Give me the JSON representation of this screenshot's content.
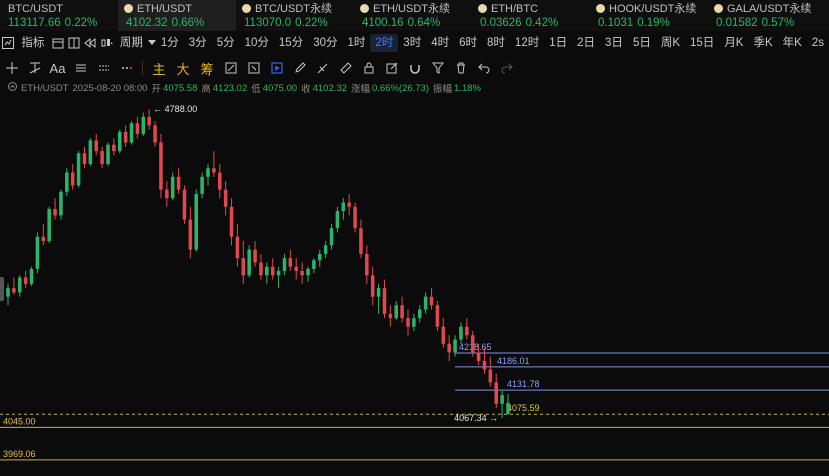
{
  "tickers": [
    {
      "name": "BTC/USDT",
      "price": "113117.66",
      "change": "0.22%",
      "dot": false,
      "active": false
    },
    {
      "name": "ETH/USDT",
      "price": "4102.32",
      "change": "0.66%",
      "dot": true,
      "active": true
    },
    {
      "name": "BTC/USDT永续",
      "price": "113070.0",
      "change": "0.22%",
      "dot": true,
      "active": false
    },
    {
      "name": "ETH/USDT永续",
      "price": "4100.16",
      "change": "0.64%",
      "dot": true,
      "active": false
    },
    {
      "name": "ETH/BTC",
      "price": "0.03626",
      "change": "0.42%",
      "dot": true,
      "active": false
    },
    {
      "name": "HOOK/USDT永续",
      "price": "0.1031",
      "change": "0.19%",
      "dot": true,
      "active": false
    },
    {
      "name": "GALA/USDT永续",
      "price": "0.01582",
      "change": "0.57%",
      "dot": true,
      "active": false
    }
  ],
  "toolbar": {
    "indicators_label": "指标",
    "period_label": "周期",
    "periods": [
      "1分",
      "3分",
      "5分",
      "10分",
      "15分",
      "30分",
      "1时",
      "2时",
      "3时",
      "4时",
      "6时",
      "8时",
      "12时",
      "1日",
      "2日",
      "3日",
      "5日",
      "周K",
      "15日",
      "月K",
      "季K",
      "年K"
    ],
    "active_period": "2时",
    "refresh_label": "2s"
  },
  "drawbar": {
    "main_label": "主",
    "big_label": "大",
    "chip_label": "筹",
    "text_label": "Aa"
  },
  "info": {
    "symbol": "ETH/USDT",
    "datetime": "2025-08-20 08:00",
    "open_label": "开",
    "open": "4075.58",
    "high_label": "高",
    "high": "4123.02",
    "low_label": "低",
    "low": "4075.00",
    "close_label": "收",
    "close": "4102.32",
    "change_label": "涨幅",
    "change": "0.66%(26.73)",
    "amp_label": "振幅",
    "amp": "1.18%"
  },
  "chart_data": {
    "type": "candlestick",
    "high_marker": "4788.00",
    "low_marker": "4067.34",
    "hlines": [
      {
        "value": 4218.65,
        "label": "4218.65",
        "color": "#8ea0ff"
      },
      {
        "value": 4186.01,
        "label": "4186.01",
        "color": "#8ea0ff"
      },
      {
        "value": 4131.78,
        "label": "4131.78",
        "color": "#8ea0ff"
      },
      {
        "value": 4075.59,
        "label": "4075.59",
        "color": "#e0c04a",
        "dashed": true
      },
      {
        "value": 4045.0,
        "label": "4045.00",
        "color": "#e0c04a"
      },
      {
        "value": 3969.06,
        "label": "3969.06",
        "color": "#e0c04a"
      }
    ],
    "up_color": "#2bb56a",
    "down_color": "#e0484f",
    "candles": [
      [
        4350,
        4380,
        4330,
        4370
      ],
      [
        4370,
        4395,
        4355,
        4360
      ],
      [
        4360,
        4400,
        4350,
        4395
      ],
      [
        4395,
        4410,
        4370,
        4380
      ],
      [
        4380,
        4420,
        4375,
        4415
      ],
      [
        4415,
        4500,
        4405,
        4490
      ],
      [
        4490,
        4520,
        4470,
        4480
      ],
      [
        4480,
        4560,
        4475,
        4555
      ],
      [
        4555,
        4580,
        4530,
        4540
      ],
      [
        4540,
        4600,
        4530,
        4595
      ],
      [
        4595,
        4650,
        4585,
        4640
      ],
      [
        4640,
        4660,
        4600,
        4610
      ],
      [
        4610,
        4690,
        4605,
        4685
      ],
      [
        4685,
        4700,
        4650,
        4660
      ],
      [
        4660,
        4720,
        4655,
        4715
      ],
      [
        4715,
        4730,
        4680,
        4690
      ],
      [
        4690,
        4700,
        4650,
        4660
      ],
      [
        4660,
        4710,
        4655,
        4705
      ],
      [
        4705,
        4720,
        4680,
        4690
      ],
      [
        4690,
        4740,
        4685,
        4735
      ],
      [
        4735,
        4750,
        4700,
        4710
      ],
      [
        4710,
        4760,
        4705,
        4755
      ],
      [
        4755,
        4770,
        4720,
        4730
      ],
      [
        4730,
        4780,
        4725,
        4770
      ],
      [
        4770,
        4788,
        4740,
        4750
      ],
      [
        4750,
        4760,
        4700,
        4710
      ],
      [
        4710,
        4730,
        4580,
        4600
      ],
      [
        4600,
        4620,
        4560,
        4580
      ],
      [
        4580,
        4640,
        4575,
        4630
      ],
      [
        4630,
        4650,
        4590,
        4600
      ],
      [
        4600,
        4610,
        4520,
        4530
      ],
      [
        4530,
        4560,
        4440,
        4460
      ],
      [
        4460,
        4600,
        4455,
        4590
      ],
      [
        4590,
        4640,
        4580,
        4630
      ],
      [
        4630,
        4660,
        4610,
        4650
      ],
      [
        4650,
        4690,
        4630,
        4640
      ],
      [
        4640,
        4660,
        4580,
        4600
      ],
      [
        4600,
        4620,
        4540,
        4560
      ],
      [
        4560,
        4580,
        4470,
        4490
      ],
      [
        4490,
        4520,
        4420,
        4440
      ],
      [
        4440,
        4480,
        4380,
        4400
      ],
      [
        4400,
        4470,
        4395,
        4460
      ],
      [
        4460,
        4480,
        4420,
        4430
      ],
      [
        4430,
        4450,
        4390,
        4400
      ],
      [
        4400,
        4430,
        4380,
        4420
      ],
      [
        4420,
        4440,
        4390,
        4400
      ],
      [
        4400,
        4420,
        4370,
        4410
      ],
      [
        4410,
        4450,
        4400,
        4440
      ],
      [
        4440,
        4460,
        4410,
        4420
      ],
      [
        4420,
        4440,
        4390,
        4410
      ],
      [
        4410,
        4430,
        4380,
        4400
      ],
      [
        4400,
        4420,
        4385,
        4415
      ],
      [
        4415,
        4440,
        4405,
        4435
      ],
      [
        4435,
        4460,
        4420,
        4450
      ],
      [
        4450,
        4480,
        4440,
        4470
      ],
      [
        4470,
        4520,
        4460,
        4510
      ],
      [
        4510,
        4560,
        4500,
        4550
      ],
      [
        4550,
        4580,
        4530,
        4570
      ],
      [
        4570,
        4590,
        4540,
        4560
      ],
      [
        4560,
        4570,
        4500,
        4510
      ],
      [
        4510,
        4530,
        4440,
        4450
      ],
      [
        4450,
        4470,
        4380,
        4400
      ],
      [
        4400,
        4420,
        4330,
        4350
      ],
      [
        4350,
        4380,
        4310,
        4370
      ],
      [
        4370,
        4390,
        4300,
        4310
      ],
      [
        4310,
        4330,
        4280,
        4300
      ],
      [
        4300,
        4340,
        4295,
        4330
      ],
      [
        4330,
        4350,
        4290,
        4300
      ],
      [
        4300,
        4320,
        4260,
        4280
      ],
      [
        4280,
        4310,
        4270,
        4300
      ],
      [
        4300,
        4330,
        4290,
        4320
      ],
      [
        4320,
        4360,
        4310,
        4350
      ],
      [
        4350,
        4370,
        4320,
        4330
      ],
      [
        4330,
        4340,
        4270,
        4280
      ],
      [
        4280,
        4300,
        4230,
        4240
      ],
      [
        4240,
        4260,
        4200,
        4220
      ],
      [
        4220,
        4260,
        4210,
        4250
      ],
      [
        4250,
        4290,
        4240,
        4280
      ],
      [
        4280,
        4300,
        4250,
        4260
      ],
      [
        4260,
        4270,
        4210,
        4220
      ],
      [
        4220,
        4240,
        4190,
        4200
      ],
      [
        4200,
        4230,
        4170,
        4180
      ],
      [
        4180,
        4210,
        4140,
        4150
      ],
      [
        4150,
        4170,
        4090,
        4100
      ],
      [
        4100,
        4130,
        4067,
        4120
      ],
      [
        4075.58,
        4123.02,
        4075,
        4102.32
      ]
    ]
  }
}
